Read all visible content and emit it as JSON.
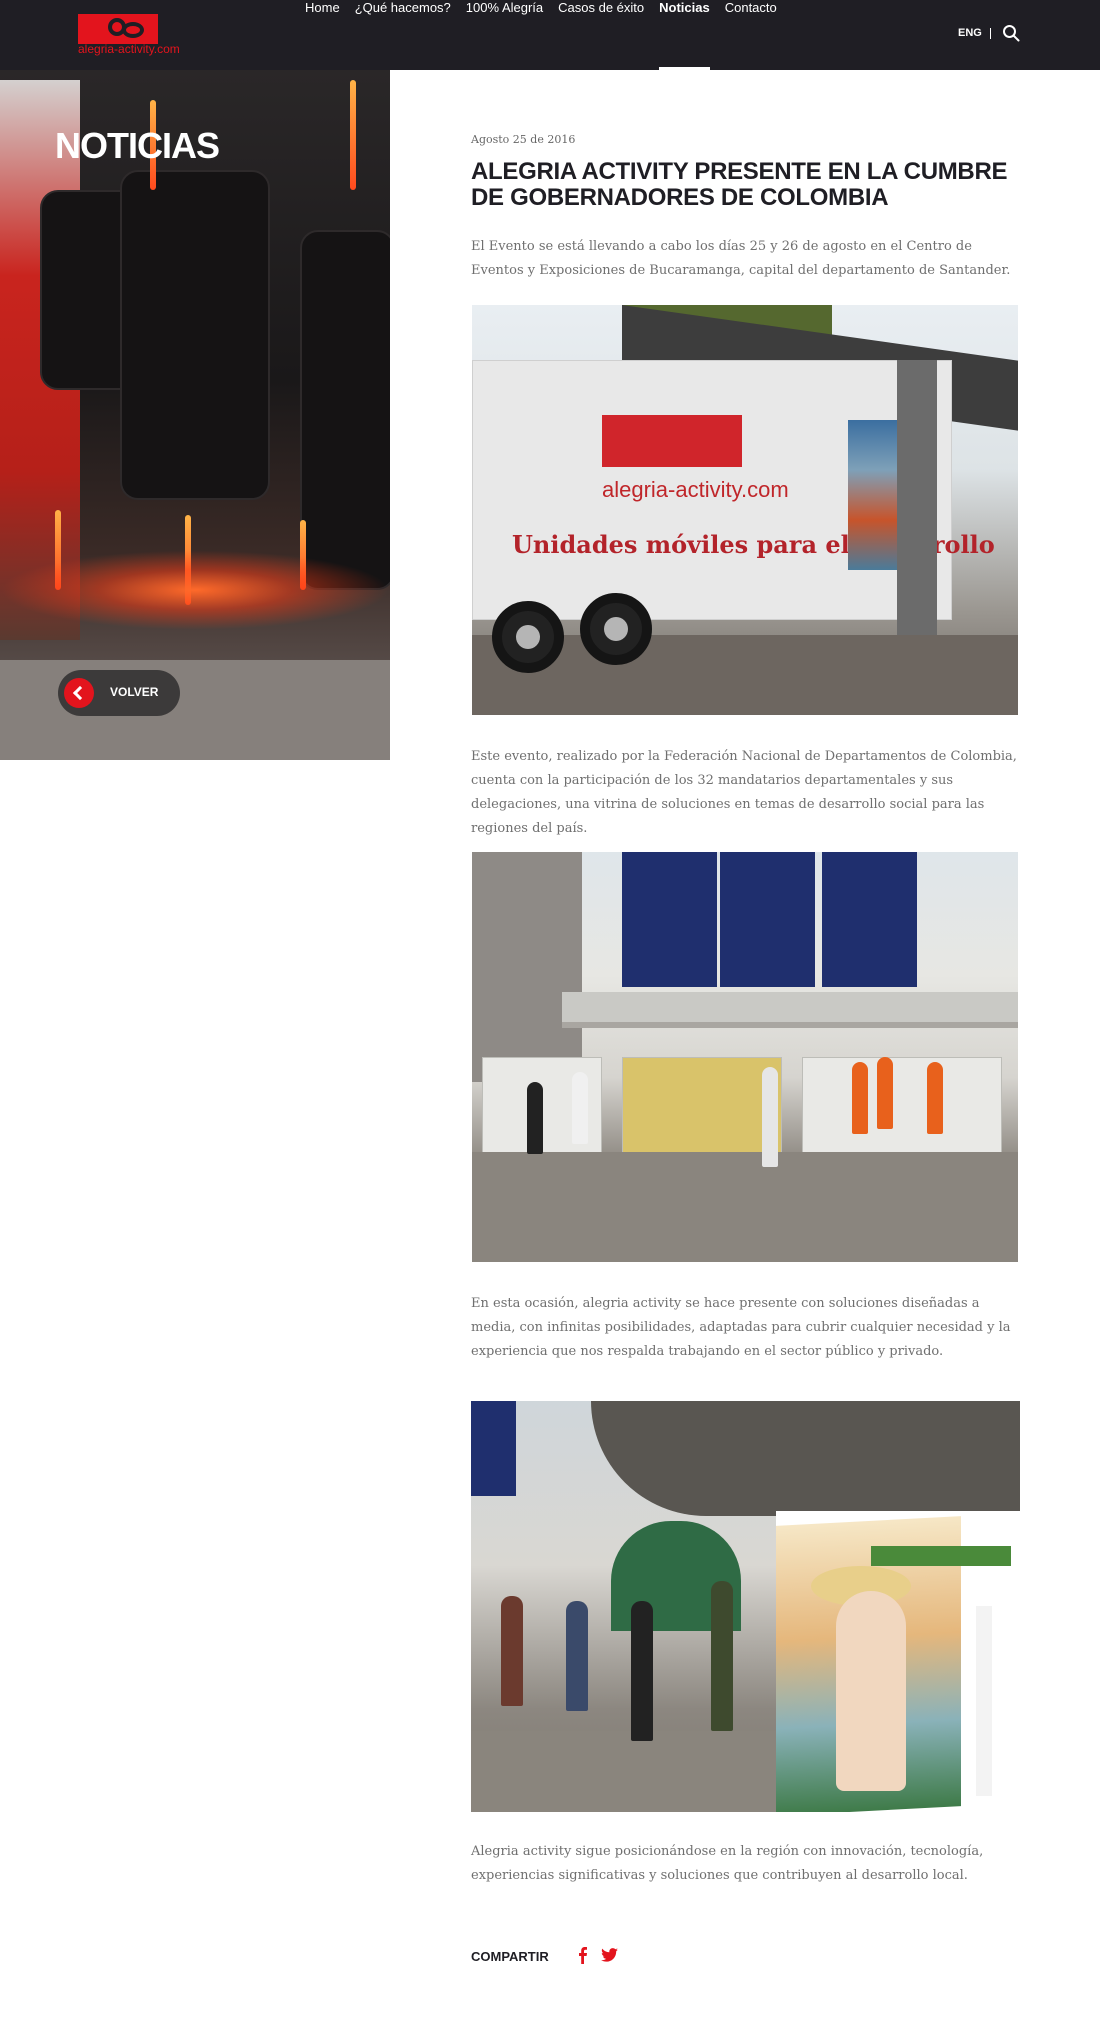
{
  "header": {
    "logo_text": "alegria-activity.com",
    "nav": [
      {
        "label": "Home"
      },
      {
        "label": "¿Qué hacemos?"
      },
      {
        "label": "100% Alegría"
      },
      {
        "label": "Casos de éxito"
      },
      {
        "label": "Noticias",
        "active": true
      },
      {
        "label": "Contacto"
      }
    ],
    "language": "ENG",
    "search_icon": "search-icon"
  },
  "hero": {
    "title": "NOTICIAS",
    "back_label": "VOLVER",
    "back_icon": "chevron-left-icon"
  },
  "article": {
    "date": "Agosto 25 de 2016",
    "title": "ALEGRIA ACTIVITY PRESENTE EN LA CUMBRE DE GOBERNADORES DE COLOMBIA",
    "paragraphs": [
      "El Evento se está llevando a cabo los días 25 y 26 de agosto en el Centro de Eventos y Exposiciones de Bucaramanga, capital del departamento de Santander.",
      "Este evento, realizado por la Federación Nacional de Departamentos de Colombia, cuenta con la participación de los 32 mandatarios departamentales y sus delegaciones, una vitrina de soluciones en temas de desarrollo social para las regiones del país.",
      "En esta ocasión, alegria activity se hace presente con soluciones diseñadas a media, con infinitas posibilidades, adaptadas para cubrir cualquier necesidad y la experiencia que nos respalda trabajando en el sector público y privado.",
      "Alegria activity sigue posicionándose en la región con innovación, tecnología, experiencias significativas y soluciones que contribuyen al desarrollo local."
    ],
    "photo1": {
      "logo_word": "alegria-activity.com",
      "slogan": "Unidades móviles para el desarrollo"
    }
  },
  "share": {
    "label": "COMPARTIR",
    "icons": [
      "facebook-icon",
      "twitter-icon"
    ]
  },
  "colors": {
    "header_bg": "#1f1e24",
    "brand_red": "#e3141d",
    "text_gray": "#6f6f6f",
    "title_dark": "#1f1e24"
  }
}
